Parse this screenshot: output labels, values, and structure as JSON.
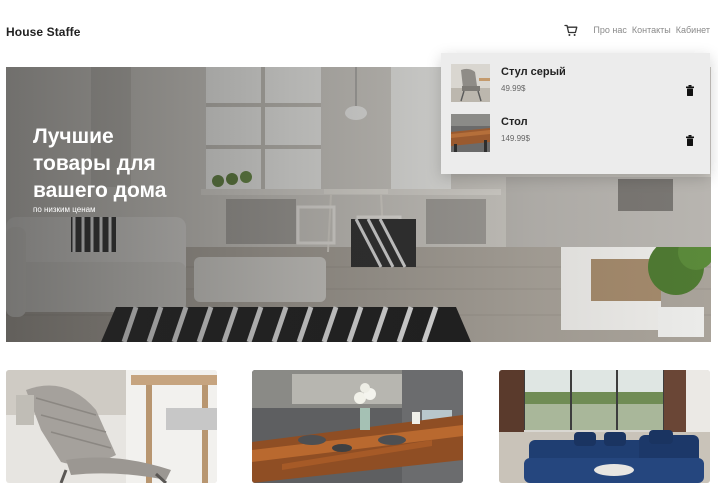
{
  "header": {
    "logo": "House Staffe",
    "cart_icon": "cart-icon",
    "nav": [
      {
        "label": "Про нас"
      },
      {
        "label": "Контакты"
      },
      {
        "label": "Кабинет"
      }
    ]
  },
  "hero": {
    "title": "Лучшие\nтовары для\nвашего дома",
    "subtitle": "по низким ценам"
  },
  "cart": {
    "items": [
      {
        "name": "Стул серый",
        "price": "49.99$",
        "delete_icon": "trash-icon"
      },
      {
        "name": "Стол",
        "price": "149.99$",
        "delete_icon": "trash-icon"
      }
    ]
  },
  "products": [
    {
      "image": "gray-chair-photo"
    },
    {
      "image": "wooden-table-photo"
    },
    {
      "image": "blue-sofa-photo"
    }
  ],
  "colors": {
    "accent": "#222222",
    "nav_text": "#8a8a8a",
    "dropdown_bg": "#ececec"
  }
}
